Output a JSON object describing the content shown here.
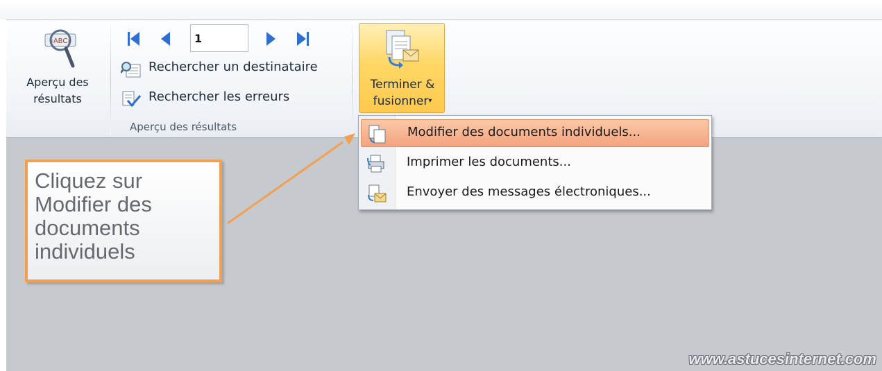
{
  "ribbon": {
    "preview_group": {
      "preview_button_label_line1": "Aperçu des",
      "preview_button_label_line2": "résultats",
      "record_value": "1",
      "find_recipient_label": "Rechercher un destinataire",
      "check_errors_label": "Rechercher les erreurs",
      "group_label": "Aperçu des résultats"
    },
    "finish_group": {
      "finish_label_line1": "Terminer &",
      "finish_label_line2": "fusionner",
      "finish_caret": "▾"
    }
  },
  "dropdown_menu": {
    "items": [
      {
        "label": "Modifier des documents individuels...",
        "icon": "edit-documents-icon",
        "highlighted": true
      },
      {
        "label": "Imprimer les documents...",
        "icon": "print-documents-icon",
        "highlighted": false
      },
      {
        "label": "Envoyer des messages électroniques...",
        "icon": "send-email-icon",
        "highlighted": false
      }
    ]
  },
  "callout": {
    "text_lines": [
      "Cliquez sur",
      "Modifier des",
      "documents",
      "individuels"
    ]
  },
  "watermark": "www.astucesinternet.com",
  "colors": {
    "accent_orange": "#f2a052",
    "highlight": "#f4a27e",
    "button_active": "#ffd766",
    "workspace": "#c6c9ce"
  }
}
